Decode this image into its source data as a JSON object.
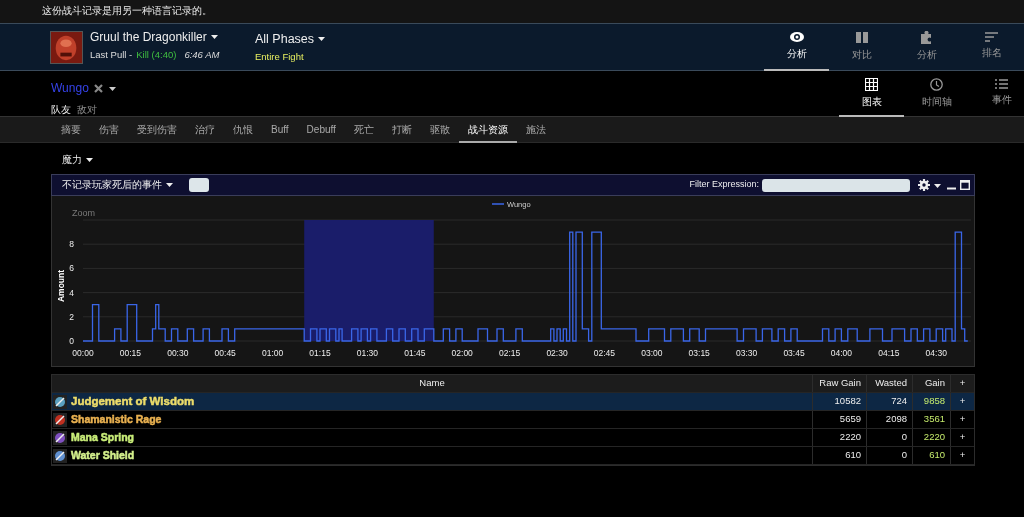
{
  "notice": "这份战斗记录是用另一种语言记录的。",
  "fight": {
    "boss": "Gruul the Dragonkiller",
    "pull": "Last Pull -",
    "result": "Kill (4:40)",
    "time": "6:46 AM",
    "phase": "All Phases",
    "phase_detail": "Entire Fight"
  },
  "top_nav": [
    {
      "label": "分析",
      "kind": "eye",
      "selected": true
    },
    {
      "label": "对比",
      "kind": "compare",
      "selected": false
    },
    {
      "label": "分析",
      "kind": "puzzle",
      "selected": false
    },
    {
      "label": "排名",
      "kind": "sort",
      "selected": false
    }
  ],
  "player": {
    "name": "Wungo",
    "filters": [
      {
        "label": "队友",
        "selected": true
      },
      {
        "label": "敌对",
        "selected": false
      }
    ]
  },
  "view_tabs": [
    {
      "label": "图表",
      "kind": "grid",
      "selected": true
    },
    {
      "label": "时间轴",
      "kind": "clock",
      "selected": false
    },
    {
      "label": "事件",
      "kind": "list",
      "selected": false
    }
  ],
  "tabs": [
    {
      "label": "摘要",
      "selected": false
    },
    {
      "label": "伤害",
      "selected": false
    },
    {
      "label": "受到伤害",
      "selected": false
    },
    {
      "label": "治疗",
      "selected": false
    },
    {
      "label": "仇恨",
      "selected": false
    },
    {
      "label": "Buff",
      "selected": false
    },
    {
      "label": "Debuff",
      "selected": false
    },
    {
      "label": "死亡",
      "selected": false
    },
    {
      "label": "打断",
      "selected": false
    },
    {
      "label": "驱散",
      "selected": false
    },
    {
      "label": "战斗资源",
      "selected": true
    },
    {
      "label": "施法",
      "selected": false
    }
  ],
  "resource": "魔力",
  "panel": {
    "death_filter": "不记录玩家死后的事件",
    "filter_label": "Filter Expression:",
    "zoom_label": "Zoom",
    "chart_data": {
      "type": "line",
      "ylabel": "Amount",
      "x": [
        0,
        3,
        3,
        5,
        5,
        10,
        10,
        12,
        12,
        14,
        14,
        17,
        17,
        22,
        22,
        23,
        23,
        24,
        24,
        26,
        26,
        28,
        28,
        30,
        30,
        33,
        33,
        35,
        35,
        38,
        38,
        40,
        40,
        44,
        44,
        46,
        46,
        48,
        48,
        70,
        70,
        72,
        72,
        74,
        74,
        75,
        75,
        77,
        77,
        78,
        78,
        80,
        80,
        81,
        81,
        82,
        82,
        85,
        85,
        87,
        87,
        88,
        88,
        90,
        90,
        91,
        91,
        93,
        93,
        96,
        96,
        98,
        98,
        100,
        100,
        102,
        102,
        104,
        104,
        106,
        106,
        108,
        108,
        111,
        111,
        114,
        114,
        116,
        116,
        118,
        118,
        120,
        120,
        125,
        125,
        128,
        128,
        131,
        131,
        133,
        133,
        137,
        137,
        139,
        139,
        148,
        148,
        149,
        149,
        150,
        150,
        151,
        151,
        152,
        152,
        153,
        153,
        154,
        154,
        155,
        155,
        156,
        156,
        158,
        158,
        160,
        160,
        161,
        161,
        164,
        164,
        175,
        175,
        179,
        179,
        184,
        184,
        186,
        186,
        190,
        190,
        192,
        192,
        195,
        195,
        197,
        197,
        207,
        207,
        209,
        209,
        213,
        213,
        215,
        215,
        218,
        218,
        220,
        220,
        222,
        222,
        224,
        224,
        226,
        226,
        234,
        234,
        236,
        236,
        238,
        238,
        240,
        240,
        242,
        242,
        245,
        245,
        249,
        249,
        253,
        253,
        256,
        256,
        260,
        260,
        262,
        262,
        264,
        264,
        266,
        266,
        268,
        268,
        270,
        270,
        272,
        272,
        273,
        273,
        275,
        275,
        276,
        276,
        278,
        278,
        279,
        279,
        280
      ],
      "series": [
        {
          "name": "Wungo",
          "color": "#3a66e8",
          "values": [
            0,
            0,
            3,
            3,
            0,
            0,
            1,
            1,
            0,
            0,
            3,
            3,
            0,
            0,
            1,
            1,
            3,
            3,
            1,
            1,
            0,
            0,
            1,
            1,
            0,
            0,
            1,
            1,
            0,
            0,
            1,
            1,
            0,
            0,
            1,
            1,
            0,
            0,
            1,
            1,
            0,
            0,
            1,
            1,
            0,
            0,
            1,
            1,
            0,
            0,
            1,
            1,
            0,
            0,
            1,
            1,
            0,
            0,
            1,
            1,
            0,
            0,
            1,
            1,
            0,
            0,
            1,
            1,
            0,
            0,
            1,
            1,
            0,
            0,
            1,
            1,
            0,
            0,
            1,
            1,
            0,
            0,
            1,
            1,
            0,
            0,
            1,
            1,
            0,
            0,
            1,
            1,
            0,
            0,
            1,
            1,
            0,
            0,
            1,
            1,
            0,
            0,
            1,
            1,
            0,
            0,
            1,
            1,
            0,
            0,
            1,
            1,
            0,
            0,
            1,
            1,
            0,
            0,
            9,
            9,
            0,
            0,
            9,
            9,
            1,
            1,
            0,
            0,
            9,
            9,
            1,
            1,
            0,
            0,
            1,
            1,
            0,
            0,
            1,
            1,
            0,
            0,
            1,
            1,
            0,
            0,
            1,
            1,
            0,
            0,
            1,
            1,
            0,
            0,
            1,
            1,
            0,
            0,
            1,
            1,
            0,
            0,
            1,
            1,
            0,
            0,
            1,
            1,
            0,
            0,
            1,
            1,
            0,
            0,
            1,
            1,
            0,
            0,
            1,
            1,
            0,
            0,
            1,
            1,
            0,
            0,
            1,
            1,
            0,
            0,
            1,
            1,
            0,
            0,
            1,
            1,
            0,
            0,
            1,
            1,
            0,
            0,
            9,
            9,
            1,
            1,
            0,
            0
          ]
        }
      ],
      "grid": true,
      "xlim": [
        0,
        281
      ],
      "ylim": [
        0,
        10
      ],
      "yticks": [
        0,
        2,
        4,
        6,
        8
      ],
      "xticks": [
        {
          "value": 0,
          "label": "00:00"
        },
        {
          "value": 15,
          "label": "00:15"
        },
        {
          "value": 30,
          "label": "00:30"
        },
        {
          "value": 45,
          "label": "00:45"
        },
        {
          "value": 60,
          "label": "01:00"
        },
        {
          "value": 75,
          "label": "01:15"
        },
        {
          "value": 90,
          "label": "01:30"
        },
        {
          "value": 105,
          "label": "01:45"
        },
        {
          "value": 120,
          "label": "02:00"
        },
        {
          "value": 135,
          "label": "02:15"
        },
        {
          "value": 150,
          "label": "02:30"
        },
        {
          "value": 165,
          "label": "02:45"
        },
        {
          "value": 180,
          "label": "03:00"
        },
        {
          "value": 195,
          "label": "03:15"
        },
        {
          "value": 210,
          "label": "03:30"
        },
        {
          "value": 225,
          "label": "03:45"
        },
        {
          "value": 240,
          "label": "04:00"
        },
        {
          "value": 255,
          "label": "04:15"
        },
        {
          "value": 270,
          "label": "04:30"
        }
      ],
      "bands": [
        {
          "axis": "x",
          "from": 70,
          "to": 111
        }
      ]
    }
  },
  "table": {
    "columns": [
      "Name",
      "Raw Gain",
      "Wasted",
      "Gain",
      "+"
    ],
    "rows": [
      {
        "name": "Judgement of Wisdom",
        "raw_gain": "10582",
        "wasted": "724",
        "gain": "9858",
        "expand": "+",
        "color": "#ecdc6a",
        "selected": true
      },
      {
        "name": "Shamanistic Rage",
        "raw_gain": "5659",
        "wasted": "2098",
        "gain": "3561",
        "expand": "+",
        "color": "#e8b050",
        "selected": false
      },
      {
        "name": "Mana Spring",
        "raw_gain": "2220",
        "wasted": "0",
        "gain": "2220",
        "expand": "+",
        "color": "#c8ec78",
        "selected": false
      },
      {
        "name": "Water Shield",
        "raw_gain": "610",
        "wasted": "0",
        "gain": "610",
        "expand": "+",
        "color": "#d4f08c",
        "selected": false
      }
    ]
  }
}
